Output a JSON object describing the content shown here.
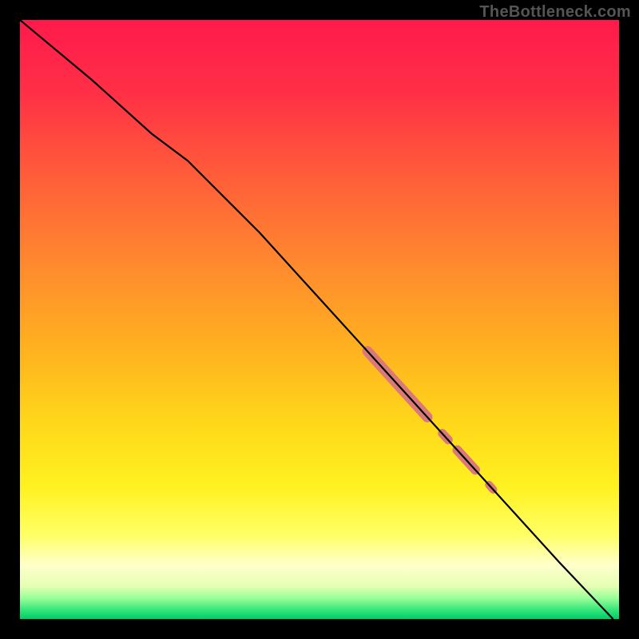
{
  "attribution": "TheBottleneck.com",
  "chart_data": {
    "type": "line",
    "title": "",
    "xlabel": "",
    "ylabel": "",
    "xlim": [
      0,
      100
    ],
    "ylim": [
      0,
      100
    ],
    "gradient_stops": [
      {
        "offset": 0.0,
        "color": "#ff1a4b"
      },
      {
        "offset": 0.12,
        "color": "#ff2f46"
      },
      {
        "offset": 0.25,
        "color": "#ff5a3a"
      },
      {
        "offset": 0.4,
        "color": "#ff872f"
      },
      {
        "offset": 0.55,
        "color": "#ffb21f"
      },
      {
        "offset": 0.68,
        "color": "#ffd91a"
      },
      {
        "offset": 0.78,
        "color": "#fff221"
      },
      {
        "offset": 0.86,
        "color": "#ffff66"
      },
      {
        "offset": 0.91,
        "color": "#ffffcc"
      },
      {
        "offset": 0.945,
        "color": "#e6ffb3"
      },
      {
        "offset": 0.965,
        "color": "#99ff99"
      },
      {
        "offset": 0.985,
        "color": "#33e67a"
      },
      {
        "offset": 1.0,
        "color": "#00cc66"
      }
    ],
    "series": [
      {
        "name": "curve",
        "color": "#000000",
        "stroke_width": 2.2,
        "points": [
          {
            "x": 0,
            "y": 100
          },
          {
            "x": 12,
            "y": 90
          },
          {
            "x": 22,
            "y": 81
          },
          {
            "x": 28,
            "y": 76.5
          },
          {
            "x": 32,
            "y": 72.5
          },
          {
            "x": 40,
            "y": 64.5
          },
          {
            "x": 50,
            "y": 53.5
          },
          {
            "x": 60,
            "y": 42.5
          },
          {
            "x": 70,
            "y": 31.5
          },
          {
            "x": 80,
            "y": 20.5
          },
          {
            "x": 90,
            "y": 9.5
          },
          {
            "x": 99,
            "y": 0
          }
        ]
      }
    ],
    "highlights": {
      "color": "#d97a78",
      "segments": [
        {
          "x0": 58,
          "y0": 44.7,
          "x1": 68,
          "y1": 33.7,
          "width": 13
        },
        {
          "x0": 70.5,
          "y0": 31.0,
          "x1": 71.5,
          "y1": 29.9,
          "width": 11
        },
        {
          "x0": 73,
          "y0": 28.2,
          "x1": 76,
          "y1": 24.9,
          "width": 12
        },
        {
          "x0": 78.3,
          "y0": 22.4,
          "x1": 79.0,
          "y1": 21.6,
          "width": 10
        }
      ]
    }
  }
}
